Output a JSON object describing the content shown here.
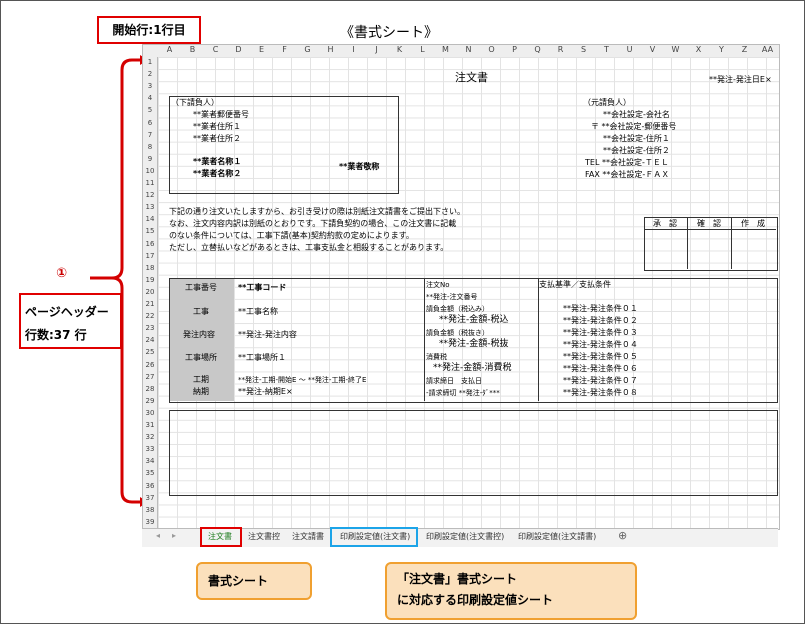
{
  "page_title": "《書式シート》",
  "start_row_label": "開始行:1行目",
  "header_label_line1": "ページヘッダー",
  "header_label_line2": "行数:37 行",
  "marker": "①",
  "columns": [
    "A",
    "B",
    "C",
    "D",
    "E",
    "F",
    "G",
    "H",
    "I",
    "J",
    "K",
    "L",
    "M",
    "N",
    "O",
    "P",
    "Q",
    "R",
    "S",
    "T",
    "U",
    "V",
    "W",
    "X",
    "Y",
    "Z",
    "AA"
  ],
  "rows": [
    "1",
    "2",
    "3",
    "4",
    "5",
    "6",
    "7",
    "8",
    "9",
    "10",
    "11",
    "12",
    "13",
    "14",
    "15",
    "16",
    "17",
    "18",
    "19",
    "20",
    "21",
    "22",
    "23",
    "24",
    "25",
    "26",
    "27",
    "28",
    "29",
    "30",
    "31",
    "32",
    "33",
    "34",
    "35",
    "36",
    "37",
    "38",
    "39"
  ],
  "doc": {
    "title": "注文書",
    "date_field": "**発注-発注日E×",
    "sub_label": "（下請負人）",
    "sub_lines": [
      "**業者郵便番号",
      "**業者住所１",
      "**業者住所２"
    ],
    "sub_names": [
      "**業者名称１",
      "**業者名称２"
    ],
    "sub_honor": "**業者敬称",
    "main_label": "（元請負人）",
    "main_lines": [
      "**会社設定-会社名",
      "〒 **会社設定-郵便番号",
      "**会社設定-住所１",
      "**会社設定-住所２",
      "TEL **会社設定-ＴＥＬ",
      "FAX **会社設定-ＦＡＸ"
    ],
    "message": [
      "下記の通り注文いたしますから、お引き受けの際は別紙注文請書をご提出下さい。",
      "なお、注文内容内訳は別紙のとおりです。下請負契約の場合、この注文書に記載",
      "のない条件については、工事下請(基本)契約約款の定めによります。",
      "ただし、立替払いなどがあるときは、工事支払金と相殺することがあります。"
    ],
    "stamps": [
      "承　認",
      "確　認",
      "作　成"
    ],
    "left_labels": [
      "工事番号",
      "工事",
      "発注内容",
      "工事場所",
      "工期",
      "納期"
    ],
    "left_values": [
      "**工事コード",
      "**工事名称",
      "**発注-発注内容",
      "**工事場所１",
      "**発注-工期-開始E ～ **発注-工期-終了E",
      "**発注-納期E×"
    ],
    "mid_labels": [
      "注文No",
      "**発注-注文番号",
      "請負金額（税込み）",
      "**発注-金額-税込",
      "請負金額（税抜き）",
      "**発注-金額-税抜",
      "消費税",
      "**発注-金額-消費税",
      "請求締日　支払日",
      "-請求締切  **発注-ﾀﾞ***"
    ],
    "pay_title": "支払基準／支払条件",
    "pay_lines": [
      "**発注-発注条件０１",
      "**発注-発注条件０２",
      "**発注-発注条件０３",
      "**発注-発注条件０４",
      "**発注-発注条件０５",
      "**発注-発注条件０６",
      "**発注-発注条件０７",
      "**発注-発注条件０８"
    ]
  },
  "tabs": [
    "注文書",
    "注文書控",
    "注文請書",
    "印刷設定値(注文書)",
    "印刷設定値(注文書控)",
    "印刷設定値(注文請書)"
  ],
  "callout1": "書式シート",
  "callout2_line1": "「注文書」書式シート",
  "callout2_line2": "に対応する印刷設定値シート"
}
